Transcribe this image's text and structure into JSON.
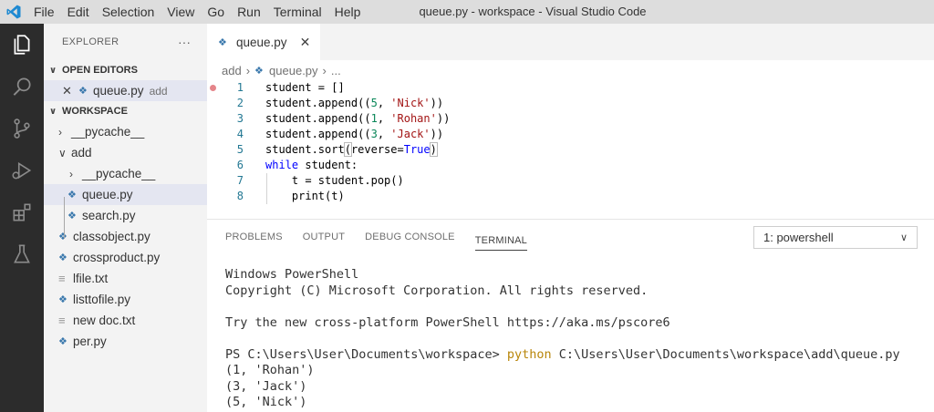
{
  "window": {
    "title": "queue.py - workspace - Visual Studio Code"
  },
  "menu": [
    "File",
    "Edit",
    "Selection",
    "View",
    "Go",
    "Run",
    "Terminal",
    "Help"
  ],
  "activity_bar": {
    "icons": [
      "explorer-icon",
      "search-icon",
      "source-control-icon",
      "run-debug-icon",
      "extensions-icon",
      "testing-icon"
    ],
    "background": "#2c2c2c"
  },
  "sidebar": {
    "title": "EXPLORER",
    "more": "···",
    "open_editors_label": "OPEN EDITORS",
    "open_editor": {
      "name": "queue.py",
      "folder": "add"
    },
    "workspace_label": "WORKSPACE",
    "tree": [
      {
        "name": "__pycache__",
        "kind": "folder-collapsed"
      },
      {
        "name": "add",
        "kind": "folder-expanded"
      },
      {
        "name": "__pycache__",
        "kind": "folder-collapsed"
      },
      {
        "name": "queue.py",
        "kind": "python"
      },
      {
        "name": "search.py",
        "kind": "python"
      },
      {
        "name": "classobject.py",
        "kind": "python"
      },
      {
        "name": "crossproduct.py",
        "kind": "python"
      },
      {
        "name": "lfile.txt",
        "kind": "text"
      },
      {
        "name": "listtofile.py",
        "kind": "python"
      },
      {
        "name": "new doc.txt",
        "kind": "text"
      },
      {
        "name": "per.py",
        "kind": "python"
      }
    ]
  },
  "editor": {
    "tab_label": "queue.py",
    "breadcrumb": {
      "folder": "add",
      "file": "queue.py",
      "rest": "..."
    },
    "line_numbers": [
      "1",
      "2",
      "3",
      "4",
      "5",
      "6",
      "7",
      "8"
    ],
    "code": {
      "l1": "student = []",
      "l2a": "student.append((",
      "l2n": "5",
      "l2b": ", ",
      "l2s": "'Nick'",
      "l2c": "))",
      "l3a": "student.append((",
      "l3n": "1",
      "l3b": ", ",
      "l3s": "'Rohan'",
      "l3c": "))",
      "l4a": "student.append((",
      "l4n": "3",
      "l4b": ", ",
      "l4s": "'Jack'",
      "l4c": "))",
      "l5a": "student.sort",
      "l5p1": "(",
      "l5b": "reverse=",
      "l5k": "True",
      "l5p2": ")",
      "l6k": "while",
      "l6b": " student:",
      "l7": "    t = student.pop()",
      "l8": "    print(t)"
    }
  },
  "panel": {
    "tabs": [
      "PROBLEMS",
      "OUTPUT",
      "DEBUG CONSOLE",
      "TERMINAL"
    ],
    "active_tab": "TERMINAL",
    "shell_select": "1: powershell",
    "terminal": {
      "line1": "Windows PowerShell",
      "line2": "Copyright (C) Microsoft Corporation. All rights reserved.",
      "line3": "Try the new cross-platform PowerShell https://aka.ms/pscore6",
      "prompt": "PS C:\\Users\\User\\Documents\\workspace> ",
      "cmd": "python",
      "arg": " C:\\Users\\User\\Documents\\workspace\\add\\queue.py",
      "out1": "(1, 'Rohan')",
      "out2": "(3, 'Jack')",
      "out3": "(5, 'Nick')"
    }
  }
}
